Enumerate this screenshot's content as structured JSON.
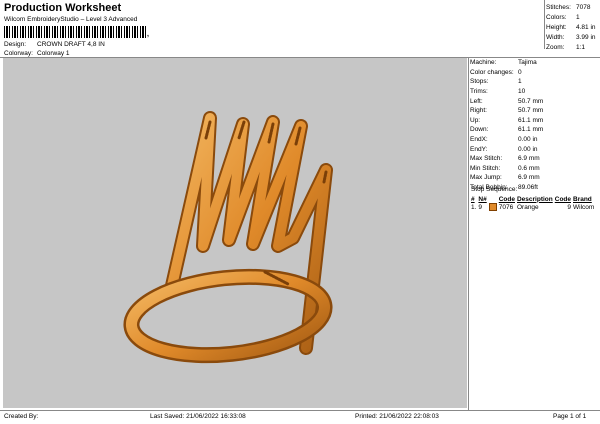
{
  "header": {
    "title": "Production Worksheet",
    "subtitle": "Wilcom EmbroideryStudio – Level 3 Advanced",
    "design_label": "Design:",
    "design_value": "CROWN DRAFT 4,8 IN",
    "colorway_label": "Colorway:",
    "colorway_value": "Colorway 1"
  },
  "stats": [
    {
      "label": "Stitches:",
      "value": "7078"
    },
    {
      "label": "Colors:",
      "value": "1"
    },
    {
      "label": "Height:",
      "value": "4.81 in"
    },
    {
      "label": "Width:",
      "value": "3.99 in"
    },
    {
      "label": "Zoom:",
      "value": "1:1"
    }
  ],
  "machine_info": [
    {
      "label": "Machine:",
      "value": "Tajima"
    },
    {
      "label": "Color changes:",
      "value": "0"
    },
    {
      "label": "Stops:",
      "value": "1"
    },
    {
      "label": "Trims:",
      "value": "10"
    },
    {
      "label": "Left:",
      "value": "50.7 mm"
    },
    {
      "label": "Right:",
      "value": "50.7 mm"
    },
    {
      "label": "Up:",
      "value": "61.1 mm"
    },
    {
      "label": "Down:",
      "value": "61.1 mm"
    },
    {
      "label": "EndX:",
      "value": "0.00 in"
    },
    {
      "label": "EndY:",
      "value": "0.00 in"
    },
    {
      "label": "Max Stitch:",
      "value": "6.9 mm"
    },
    {
      "label": "Min Stitch:",
      "value": "0.6 mm"
    },
    {
      "label": "Max Jump:",
      "value": "6.9 mm"
    },
    {
      "label": "Total Bobbin:",
      "value": "89.06ft"
    }
  ],
  "stop_sequence": {
    "title": "Stop Sequence:",
    "headers": [
      "#",
      "N#",
      "",
      "Code",
      "Description",
      "Code",
      "Brand"
    ],
    "rows": [
      {
        "num": "1.",
        "n": "9",
        "color": "#e08a2a",
        "code": "7076",
        "description": "Orange",
        "code2": "9",
        "brand": "Wilcom"
      }
    ]
  },
  "footer": {
    "created_by": "Created By:",
    "last_saved": "Last Saved: 21/06/2022 16:33:08",
    "printed": "Printed: 21/06/2022 22:08:03",
    "page": "Page 1 of 1"
  }
}
